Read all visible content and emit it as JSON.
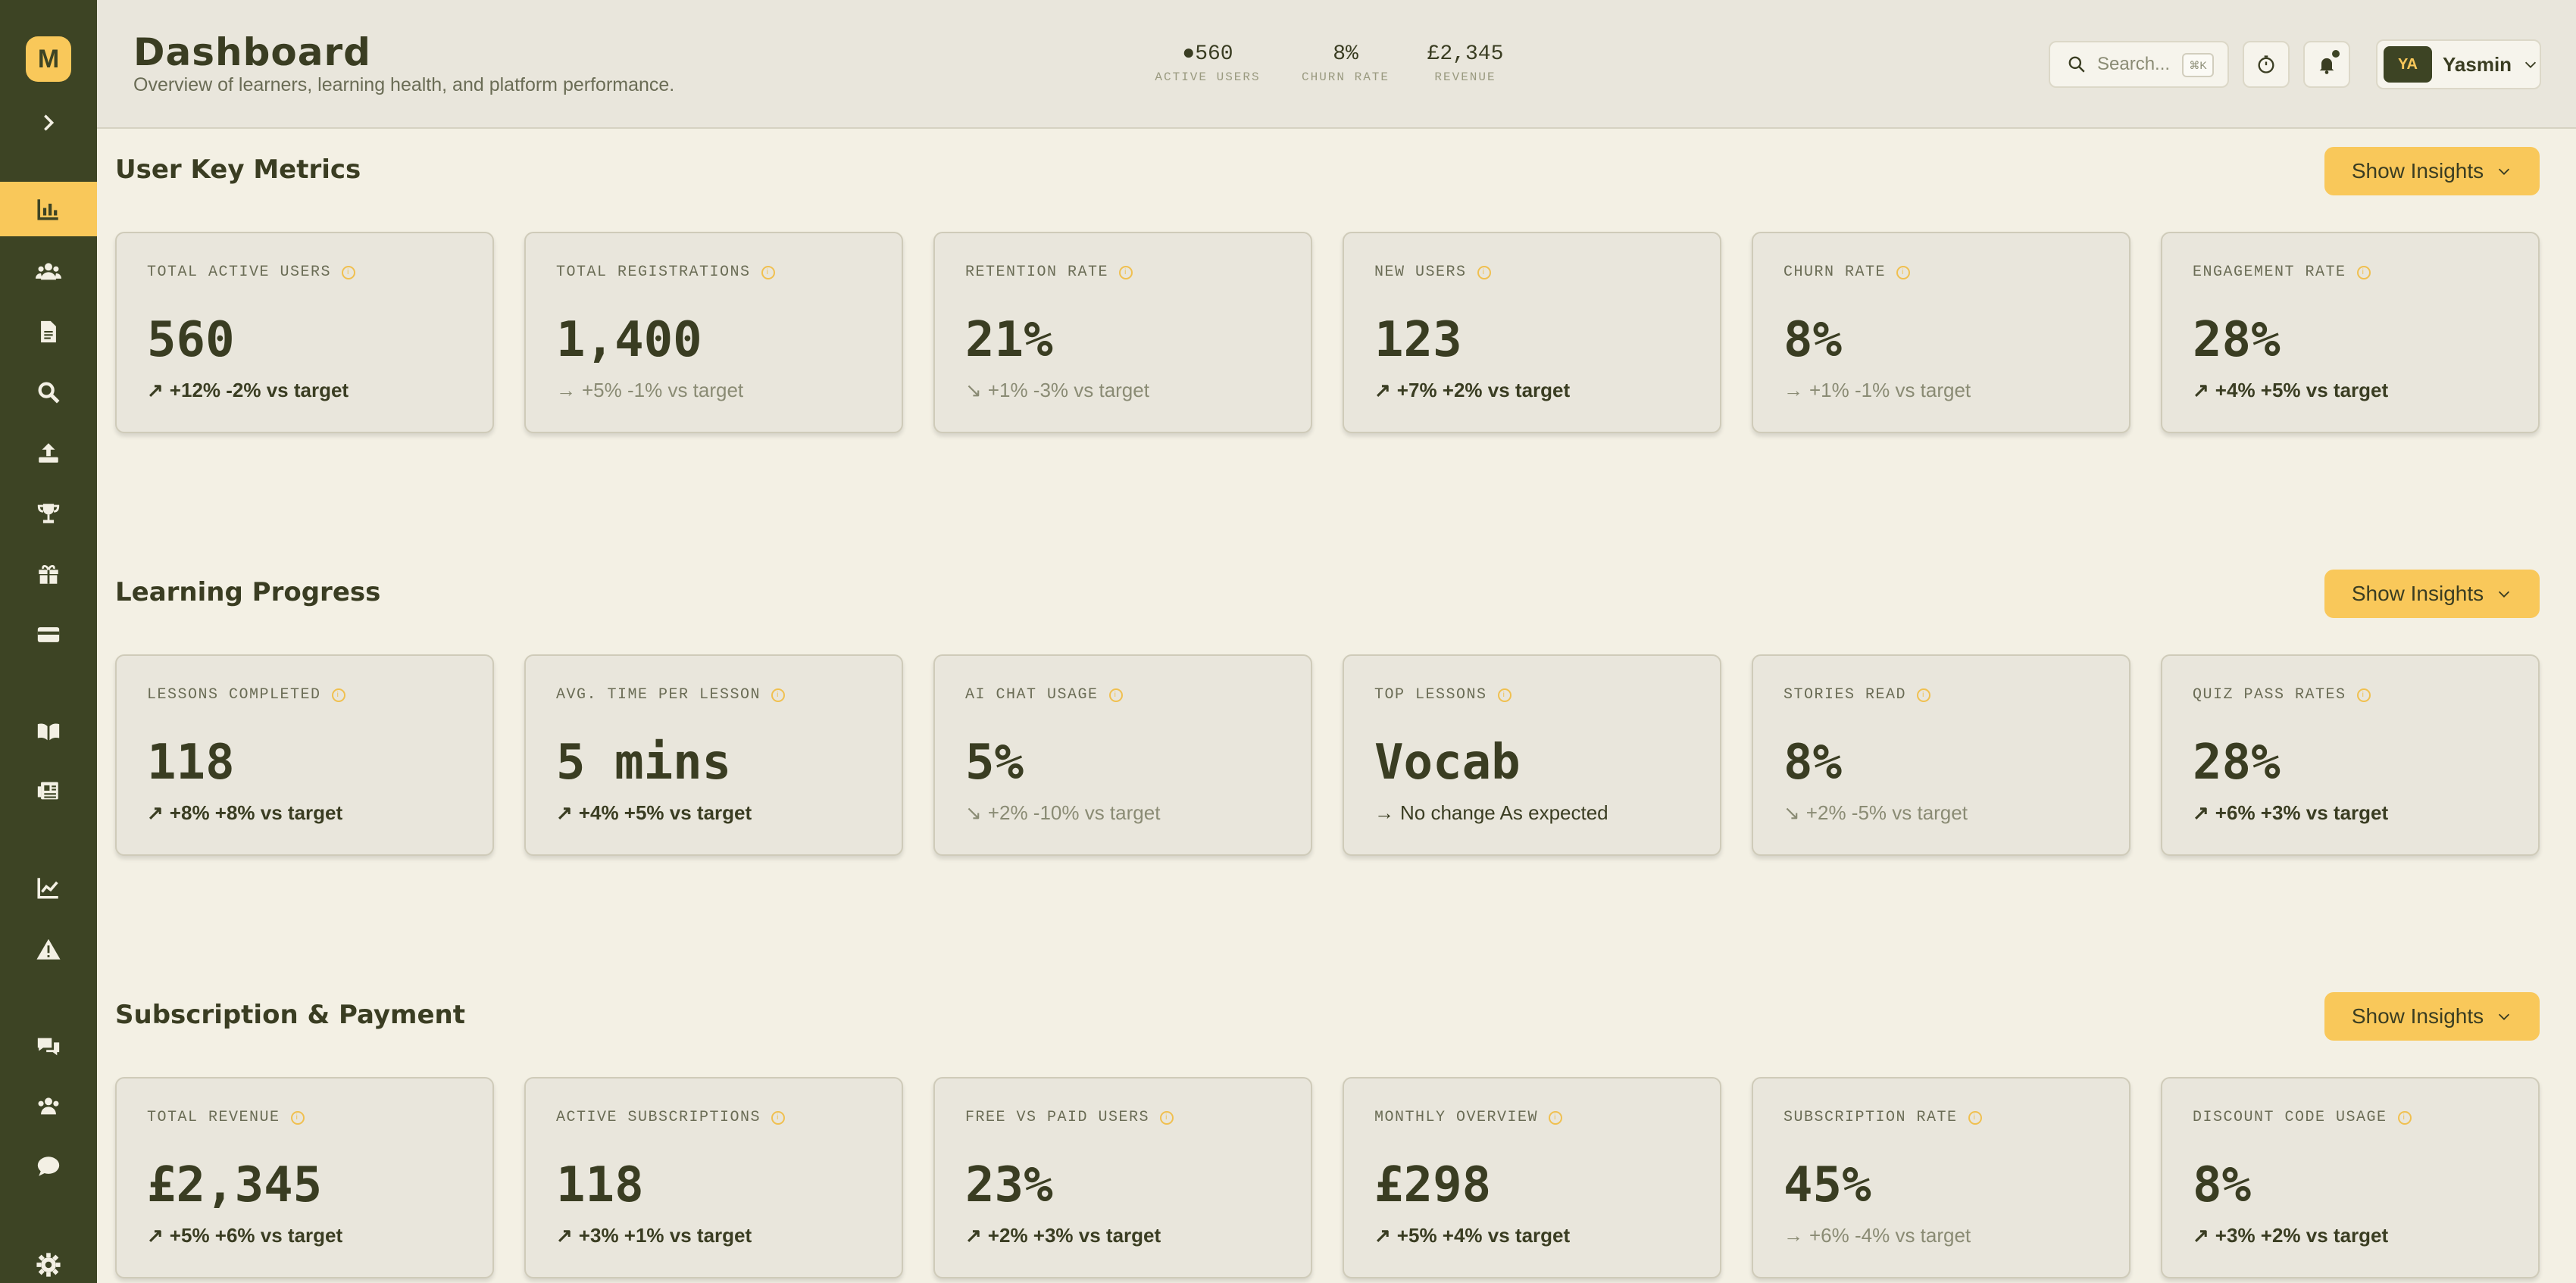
{
  "brand": {
    "logo_letter": "M"
  },
  "header": {
    "title": "Dashboard",
    "subtitle": "Overview of learners, learning health, and platform performance.",
    "stats": [
      {
        "value": "●560",
        "label": "ACTIVE USERS"
      },
      {
        "value": "8%",
        "label": "CHURN RATE"
      },
      {
        "value": "£2,345",
        "label": "REVENUE"
      }
    ],
    "search_placeholder": "Search...",
    "search_shortcut": "⌘K",
    "user": {
      "initials": "YA",
      "name": "Yasmin"
    }
  },
  "insights_label": "Show Insights",
  "sections": [
    {
      "title": "User Key Metrics",
      "cards": [
        {
          "label": "TOTAL ACTIVE USERS",
          "value": "560",
          "arrow": "↗",
          "trend": "+12% -2% vs target",
          "tone": "up"
        },
        {
          "label": "TOTAL REGISTRATIONS",
          "value": "1,400",
          "arrow": "→",
          "trend": "+5% -1% vs target",
          "tone": "muted"
        },
        {
          "label": "RETENTION RATE",
          "value": "21%",
          "arrow": "↘",
          "trend": "+1% -3% vs target",
          "tone": "muted"
        },
        {
          "label": "NEW USERS",
          "value": "123",
          "arrow": "↗",
          "trend": "+7% +2% vs target",
          "tone": "up"
        },
        {
          "label": "CHURN RATE",
          "value": "8%",
          "arrow": "→",
          "trend": "+1% -1% vs target",
          "tone": "muted"
        },
        {
          "label": "ENGAGEMENT RATE",
          "value": "28%",
          "arrow": "↗",
          "trend": "+4% +5% vs target",
          "tone": "up"
        }
      ]
    },
    {
      "title": "Learning Progress",
      "cards": [
        {
          "label": "LESSONS COMPLETED",
          "value": "118",
          "arrow": "↗",
          "trend": "+8% +8% vs target",
          "tone": "up"
        },
        {
          "label": "AVG. TIME PER LESSON",
          "value": "5 mins",
          "arrow": "↗",
          "trend": "+4% +5% vs target",
          "tone": "up"
        },
        {
          "label": "AI CHAT USAGE",
          "value": "5%",
          "arrow": "↘",
          "trend": "+2% -10% vs target",
          "tone": "muted"
        },
        {
          "label": "TOP LESSONS",
          "value": "Vocab",
          "arrow": "→",
          "trend": "No change As expected",
          "tone": "neutral"
        },
        {
          "label": "STORIES READ",
          "value": "8%",
          "arrow": "↘",
          "trend": "+2% -5% vs target",
          "tone": "muted"
        },
        {
          "label": "QUIZ PASS RATES",
          "value": "28%",
          "arrow": "↗",
          "trend": "+6% +3% vs target",
          "tone": "up"
        }
      ]
    },
    {
      "title": "Subscription & Payment",
      "cards": [
        {
          "label": "TOTAL REVENUE",
          "value": "£2,345",
          "arrow": "↗",
          "trend": "+5% +6% vs target",
          "tone": "up"
        },
        {
          "label": "ACTIVE SUBSCRIPTIONS",
          "value": "118",
          "arrow": "↗",
          "trend": "+3% +1% vs target",
          "tone": "up"
        },
        {
          "label": "FREE VS PAID USERS",
          "value": "23%",
          "arrow": "↗",
          "trend": "+2% +3% vs target",
          "tone": "up"
        },
        {
          "label": "MONTHLY OVERVIEW",
          "value": "£298",
          "arrow": "↗",
          "trend": "+5% +4% vs target",
          "tone": "up"
        },
        {
          "label": "SUBSCRIPTION RATE",
          "value": "45%",
          "arrow": "→",
          "trend": "+6% -4% vs target",
          "tone": "muted"
        },
        {
          "label": "DISCOUNT CODE USAGE",
          "value": "8%",
          "arrow": "↗",
          "trend": "+3% +2% vs target",
          "tone": "up"
        }
      ]
    }
  ],
  "sidebar_icons": [
    "analytics-icon",
    "users-icon",
    "document-icon",
    "search-icon",
    "upload-icon",
    "trophy-icon",
    "gift-icon",
    "credit-card-icon",
    "book-icon",
    "news-icon",
    "line-chart-icon",
    "warning-icon",
    "chat-icon",
    "group-icon",
    "message-icon",
    "settings-icon"
  ],
  "colors": {
    "sidebar": "#3d4424",
    "accent": "#f9c85a",
    "background": "#f3f0e4",
    "card": "#e9e6dc",
    "text": "#3a3d22"
  }
}
